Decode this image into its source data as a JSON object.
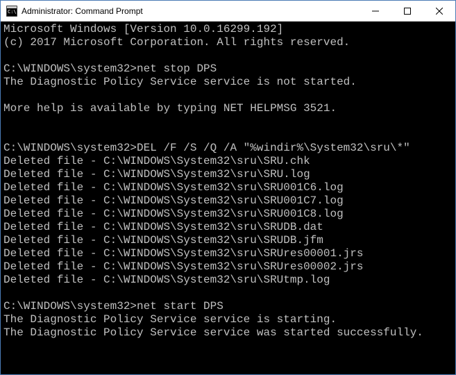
{
  "title": "Administrator: Command Prompt",
  "terminal": {
    "lines": [
      "Microsoft Windows [Version 10.0.16299.192]",
      "(c) 2017 Microsoft Corporation. All rights reserved.",
      "",
      "C:\\WINDOWS\\system32>net stop DPS",
      "The Diagnostic Policy Service service is not started.",
      "",
      "More help is available by typing NET HELPMSG 3521.",
      "",
      "",
      "C:\\WINDOWS\\system32>DEL /F /S /Q /A \"%windir%\\System32\\sru\\*\"",
      "Deleted file - C:\\WINDOWS\\System32\\sru\\SRU.chk",
      "Deleted file - C:\\WINDOWS\\System32\\sru\\SRU.log",
      "Deleted file - C:\\WINDOWS\\System32\\sru\\SRU001C6.log",
      "Deleted file - C:\\WINDOWS\\System32\\sru\\SRU001C7.log",
      "Deleted file - C:\\WINDOWS\\System32\\sru\\SRU001C8.log",
      "Deleted file - C:\\WINDOWS\\System32\\sru\\SRUDB.dat",
      "Deleted file - C:\\WINDOWS\\System32\\sru\\SRUDB.jfm",
      "Deleted file - C:\\WINDOWS\\System32\\sru\\SRUres00001.jrs",
      "Deleted file - C:\\WINDOWS\\System32\\sru\\SRUres00002.jrs",
      "Deleted file - C:\\WINDOWS\\System32\\sru\\SRUtmp.log",
      "",
      "C:\\WINDOWS\\system32>net start DPS",
      "The Diagnostic Policy Service service is starting.",
      "The Diagnostic Policy Service service was started successfully.",
      ""
    ]
  }
}
